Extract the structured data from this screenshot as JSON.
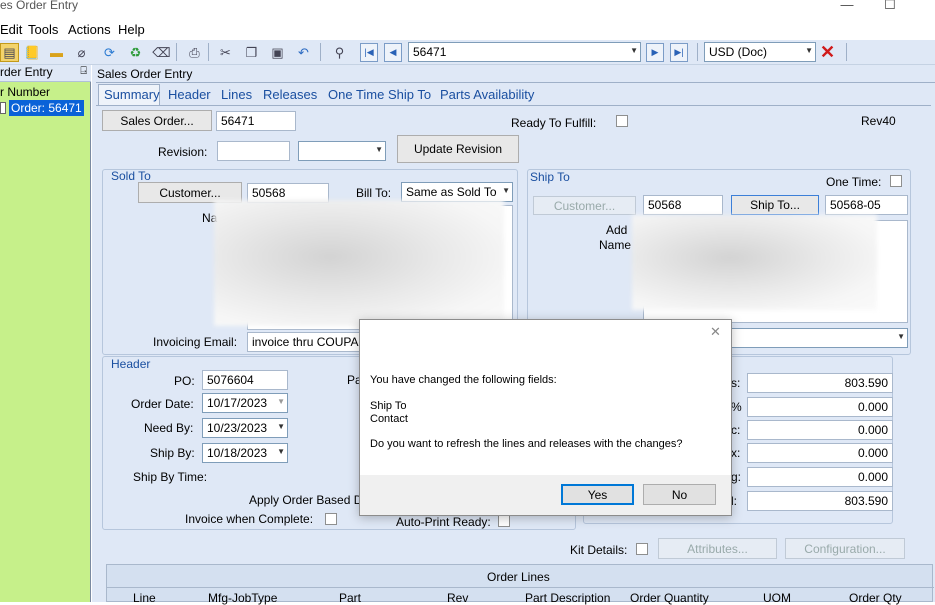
{
  "window": {
    "title": "es Order Entry",
    "min": "—",
    "max": "☐"
  },
  "menu": [
    "Edit",
    "Tools",
    "Actions",
    "Help"
  ],
  "toolbar": {
    "order_combo": "56471",
    "currency_combo": "USD (Doc)",
    "delete_glyph": "✕"
  },
  "tree": {
    "header": "rder Entry",
    "pin": "⍈",
    "root": "r Number",
    "item": "Order: 56471"
  },
  "panel_title": "Sales Order Entry",
  "tabs": [
    "Summary",
    "Header",
    "Lines",
    "Releases",
    "One Time Ship To",
    "Parts Availability"
  ],
  "top": {
    "sales_order_btn": "Sales Order...",
    "sales_order_val": "56471",
    "revision_label": "Revision:",
    "update_revision_btn": "Update Revision",
    "ready_label": "Ready To Fulfill:",
    "rev_text": "Rev40"
  },
  "sold_to": {
    "title": "Sold To",
    "customer_btn": "Customer...",
    "customer_val": "50568",
    "bill_to_label": "Bill To:",
    "bill_to_val": "Same as Sold To",
    "name_label": "Na",
    "invoicing_label": "Invoicing Email:",
    "invoicing_val": "invoice thru COUPA"
  },
  "ship_to": {
    "title": "Ship To",
    "one_time_label": "One Time:",
    "customer_btn": "Customer...",
    "customer_val": "50568",
    "ship_to_btn": "Ship To...",
    "ship_to_val": "50568-05",
    "addr_label": "Add",
    "name_label": "Name"
  },
  "header_group": {
    "title": "Header",
    "po_label": "PO:",
    "po_val": "5076604",
    "pa_label": "Pa",
    "order_date_label": "Order Date:",
    "order_date_val": "10/17/2023",
    "need_by_label": "Need By:",
    "need_by_val": "10/23/2023",
    "ship_by_label": "Ship By:",
    "ship_by_val": "10/18/2023",
    "ship_by_time_label": "Ship By Time:",
    "apply_label": "Apply Order Based D",
    "invoice_complete_label": "Invoice when Complete:",
    "autoprint_label": "Auto-Print Ready:"
  },
  "totals": {
    "labels": [
      "s:",
      "%",
      "c:",
      "x:",
      "g:",
      "l:"
    ],
    "values": [
      "803.590",
      "0.000",
      "0.000",
      "0.000",
      "0.000",
      "803.590"
    ]
  },
  "kit": {
    "label": "Kit Details:",
    "attributes_btn": "Attributes...",
    "configuration_btn": "Configuration..."
  },
  "order_lines": {
    "title": "Order Lines",
    "columns": [
      "Line",
      "Mfg-JobType",
      "Part",
      "Rev",
      "Part Description",
      "Order Quantity",
      "UOM",
      "Order Qty"
    ]
  },
  "dialog": {
    "close": "✕",
    "line1": "You have changed the following fields:",
    "field1": "Ship To",
    "field2": "Contact",
    "question": "Do you want to refresh the lines and releases with the changes?",
    "yes": "Yes",
    "no": "No"
  }
}
